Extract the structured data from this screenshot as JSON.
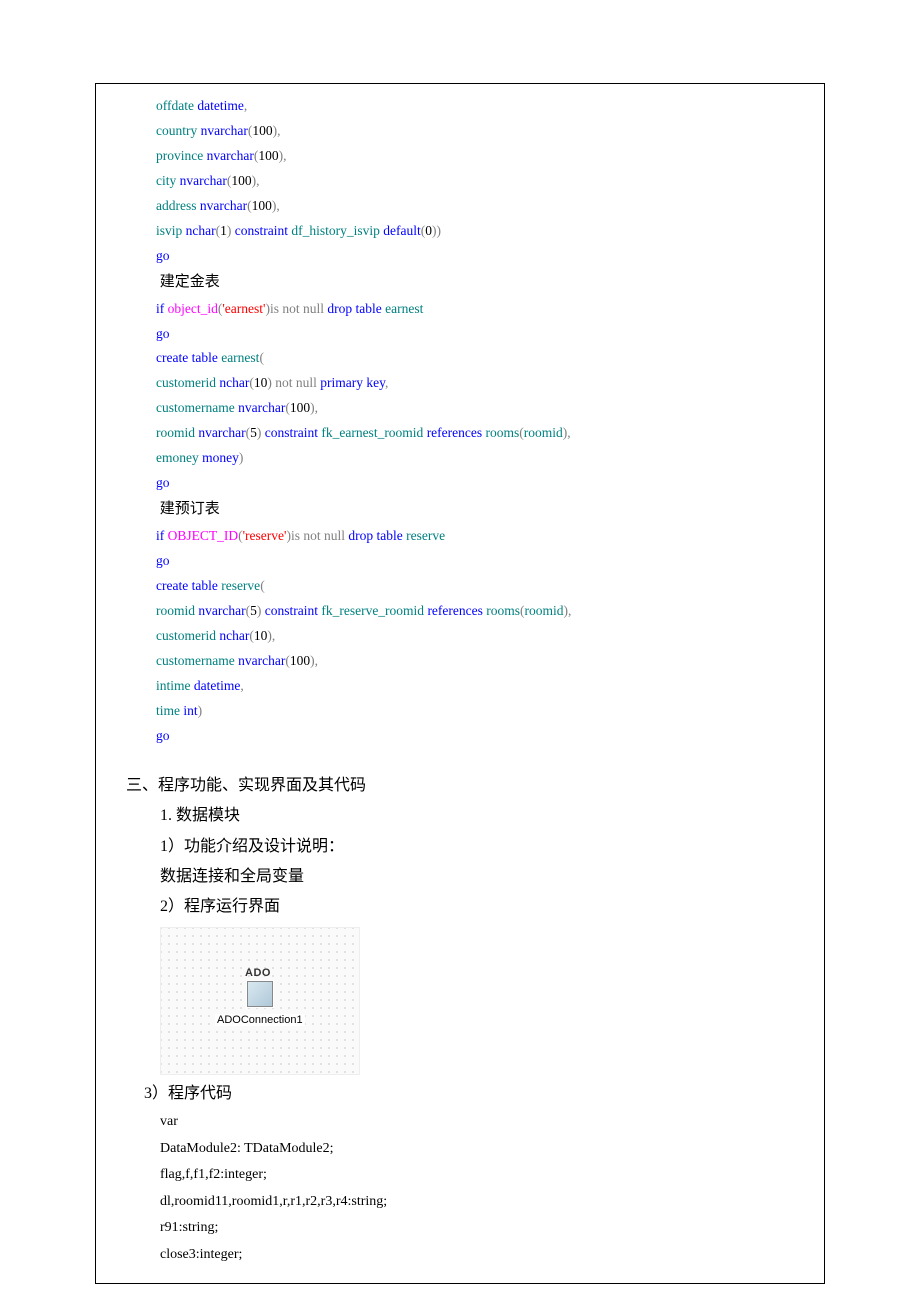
{
  "sql": {
    "lines": [
      [
        {
          "t": "offdate ",
          "c": "tk-teal"
        },
        {
          "t": "datetime",
          "c": "tk-blue"
        },
        {
          "t": ",",
          "c": "tk-gray"
        }
      ],
      [
        {
          "t": "country ",
          "c": "tk-teal"
        },
        {
          "t": "nvarchar",
          "c": "tk-blue"
        },
        {
          "t": "(",
          "c": "tk-gray"
        },
        {
          "t": "100",
          "c": "tk-black"
        },
        {
          "t": "),",
          "c": "tk-gray"
        }
      ],
      [
        {
          "t": "province ",
          "c": "tk-teal"
        },
        {
          "t": "nvarchar",
          "c": "tk-blue"
        },
        {
          "t": "(",
          "c": "tk-gray"
        },
        {
          "t": "100",
          "c": "tk-black"
        },
        {
          "t": "),",
          "c": "tk-gray"
        }
      ],
      [
        {
          "t": "city ",
          "c": "tk-teal"
        },
        {
          "t": "nvarchar",
          "c": "tk-blue"
        },
        {
          "t": "(",
          "c": "tk-gray"
        },
        {
          "t": "100",
          "c": "tk-black"
        },
        {
          "t": "),",
          "c": "tk-gray"
        }
      ],
      [
        {
          "t": "address ",
          "c": "tk-teal"
        },
        {
          "t": "nvarchar",
          "c": "tk-blue"
        },
        {
          "t": "(",
          "c": "tk-gray"
        },
        {
          "t": "100",
          "c": "tk-black"
        },
        {
          "t": "),",
          "c": "tk-gray"
        }
      ],
      [
        {
          "t": "isvip ",
          "c": "tk-teal"
        },
        {
          "t": "nchar",
          "c": "tk-blue"
        },
        {
          "t": "(",
          "c": "tk-gray"
        },
        {
          "t": "1",
          "c": "tk-black"
        },
        {
          "t": ") ",
          "c": "tk-gray"
        },
        {
          "t": "constraint ",
          "c": "tk-blue"
        },
        {
          "t": "df_history_isvip ",
          "c": "tk-teal"
        },
        {
          "t": "default",
          "c": "tk-blue"
        },
        {
          "t": "(",
          "c": "tk-gray"
        },
        {
          "t": "0",
          "c": "tk-black"
        },
        {
          "t": "))",
          "c": "tk-gray"
        }
      ],
      [
        {
          "t": "go",
          "c": "tk-blue"
        }
      ],
      [
        {
          "t": " 建定金表",
          "c": "comment-cn"
        }
      ],
      [
        {
          "t": "if ",
          "c": "tk-blue"
        },
        {
          "t": "object_id",
          "c": "tk-magenta"
        },
        {
          "t": "(",
          "c": "tk-gray"
        },
        {
          "t": "'earnest'",
          "c": "tk-red"
        },
        {
          "t": ")",
          "c": "tk-gray"
        },
        {
          "t": "is not null ",
          "c": "tk-gray"
        },
        {
          "t": "drop table ",
          "c": "tk-blue"
        },
        {
          "t": "earnest",
          "c": "tk-teal"
        }
      ],
      [
        {
          "t": "go",
          "c": "tk-blue"
        }
      ],
      [
        {
          "t": "create table ",
          "c": "tk-blue"
        },
        {
          "t": "earnest",
          "c": "tk-teal"
        },
        {
          "t": "(",
          "c": "tk-gray"
        }
      ],
      [
        {
          "t": "customerid ",
          "c": "tk-teal"
        },
        {
          "t": "nchar",
          "c": "tk-blue"
        },
        {
          "t": "(",
          "c": "tk-gray"
        },
        {
          "t": "10",
          "c": "tk-black"
        },
        {
          "t": ") ",
          "c": "tk-gray"
        },
        {
          "t": "not null ",
          "c": "tk-gray"
        },
        {
          "t": "primary key",
          "c": "tk-blue"
        },
        {
          "t": ",",
          "c": "tk-gray"
        }
      ],
      [
        {
          "t": "customername ",
          "c": "tk-teal"
        },
        {
          "t": "nvarchar",
          "c": "tk-blue"
        },
        {
          "t": "(",
          "c": "tk-gray"
        },
        {
          "t": "100",
          "c": "tk-black"
        },
        {
          "t": "),",
          "c": "tk-gray"
        }
      ],
      [
        {
          "t": "roomid ",
          "c": "tk-teal"
        },
        {
          "t": "nvarchar",
          "c": "tk-blue"
        },
        {
          "t": "(",
          "c": "tk-gray"
        },
        {
          "t": "5",
          "c": "tk-black"
        },
        {
          "t": ") ",
          "c": "tk-gray"
        },
        {
          "t": "constraint ",
          "c": "tk-blue"
        },
        {
          "t": "fk_earnest_roomid ",
          "c": "tk-teal"
        },
        {
          "t": "references ",
          "c": "tk-blue"
        },
        {
          "t": "rooms",
          "c": "tk-teal"
        },
        {
          "t": "(",
          "c": "tk-gray"
        },
        {
          "t": "roomid",
          "c": "tk-teal"
        },
        {
          "t": "),",
          "c": "tk-gray"
        }
      ],
      [
        {
          "t": "emoney ",
          "c": "tk-teal"
        },
        {
          "t": "money",
          "c": "tk-blue"
        },
        {
          "t": ")",
          "c": "tk-gray"
        }
      ],
      [
        {
          "t": "go",
          "c": "tk-blue"
        }
      ],
      [
        {
          "t": " 建预订表",
          "c": "comment-cn"
        }
      ],
      [
        {
          "t": "if ",
          "c": "tk-blue"
        },
        {
          "t": "OBJECT_ID",
          "c": "tk-magenta"
        },
        {
          "t": "(",
          "c": "tk-gray"
        },
        {
          "t": "'reserve'",
          "c": "tk-red"
        },
        {
          "t": ")",
          "c": "tk-gray"
        },
        {
          "t": "is not null ",
          "c": "tk-gray"
        },
        {
          "t": "drop table ",
          "c": "tk-blue"
        },
        {
          "t": "reserve",
          "c": "tk-teal"
        }
      ],
      [
        {
          "t": "go",
          "c": "tk-blue"
        }
      ],
      [
        {
          "t": "create table ",
          "c": "tk-blue"
        },
        {
          "t": "reserve",
          "c": "tk-teal"
        },
        {
          "t": "(",
          "c": "tk-gray"
        }
      ],
      [
        {
          "t": "roomid ",
          "c": "tk-teal"
        },
        {
          "t": "nvarchar",
          "c": "tk-blue"
        },
        {
          "t": "(",
          "c": "tk-gray"
        },
        {
          "t": "5",
          "c": "tk-black"
        },
        {
          "t": ") ",
          "c": "tk-gray"
        },
        {
          "t": "constraint ",
          "c": "tk-blue"
        },
        {
          "t": "fk_reserve_roomid ",
          "c": "tk-teal"
        },
        {
          "t": "references ",
          "c": "tk-blue"
        },
        {
          "t": "rooms",
          "c": "tk-teal"
        },
        {
          "t": "(",
          "c": "tk-gray"
        },
        {
          "t": "roomid",
          "c": "tk-teal"
        },
        {
          "t": "),",
          "c": "tk-gray"
        }
      ],
      [
        {
          "t": "customerid ",
          "c": "tk-teal"
        },
        {
          "t": "nchar",
          "c": "tk-blue"
        },
        {
          "t": "(",
          "c": "tk-gray"
        },
        {
          "t": "10",
          "c": "tk-black"
        },
        {
          "t": "),",
          "c": "tk-gray"
        }
      ],
      [
        {
          "t": "customername ",
          "c": "tk-teal"
        },
        {
          "t": "nvarchar",
          "c": "tk-blue"
        },
        {
          "t": "(",
          "c": "tk-gray"
        },
        {
          "t": "100",
          "c": "tk-black"
        },
        {
          "t": "),",
          "c": "tk-gray"
        }
      ],
      [
        {
          "t": "intime ",
          "c": "tk-teal"
        },
        {
          "t": "datetime",
          "c": "tk-blue"
        },
        {
          "t": ",",
          "c": "tk-gray"
        }
      ],
      [
        {
          "t": "time ",
          "c": "tk-teal"
        },
        {
          "t": "int",
          "c": "tk-blue"
        },
        {
          "t": ")",
          "c": "tk-gray"
        }
      ],
      [
        {
          "t": "go",
          "c": "tk-blue"
        }
      ]
    ]
  },
  "section3": {
    "heading": "三、程序功能、实现界面及其代码",
    "item1": "1. 数据模块",
    "item1_1": "1）功能介绍及设计说明：",
    "item1_desc": "数据连接和全局变量",
    "item1_2": "2）程序运行界面",
    "ado_top": "ADO",
    "ado_name": "ADOConnection1",
    "item3": "3）程序代码",
    "code": [
      "var",
      "DataModule2: TDataModule2;",
      "flag,f,f1,f2:integer;",
      "dl,roomid11,roomid1,r,r1,r2,r3,r4:string;",
      "r91:string;",
      "close3:integer;"
    ]
  }
}
